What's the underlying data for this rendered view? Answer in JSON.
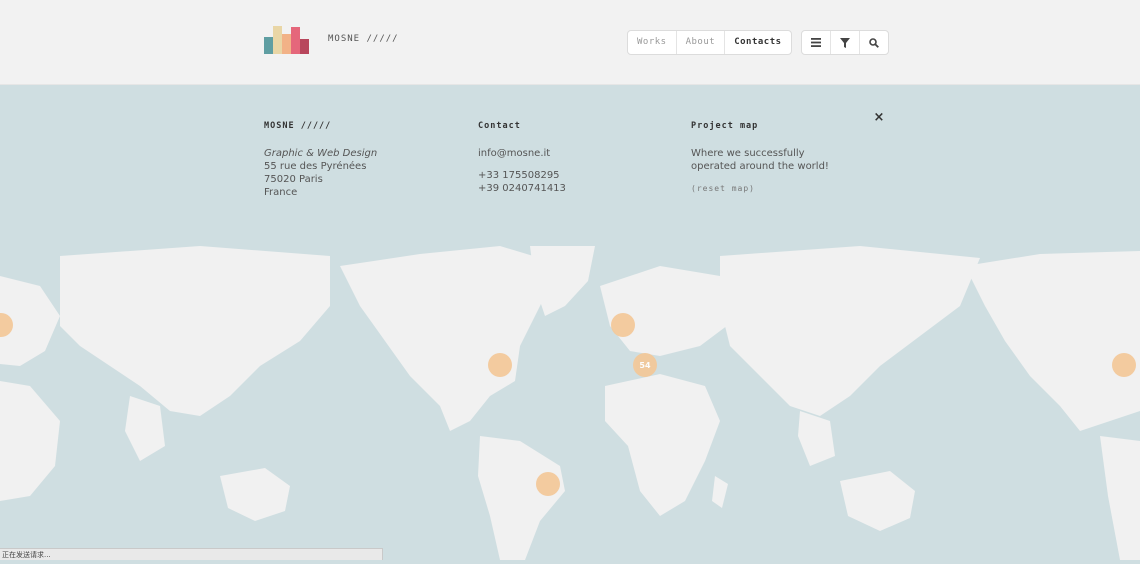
{
  "header": {
    "brand": "MOSNE /////",
    "nav": [
      {
        "label": "Works",
        "active": false
      },
      {
        "label": "About",
        "active": false
      },
      {
        "label": "Contacts",
        "active": true
      }
    ],
    "tools": [
      "menu-icon",
      "filter-icon",
      "search-icon"
    ],
    "logo_colors": [
      "#5f9ea2",
      "#e9d6a6",
      "#f2b287",
      "#e5677b",
      "#b8465c"
    ]
  },
  "panel": {
    "col1": {
      "heading": "MOSNE /////",
      "tagline": "Graphic & Web Design",
      "address1": "55 rue des Pyrénées",
      "address2": "75020 Paris",
      "country": "France"
    },
    "col2": {
      "heading": "Contact",
      "email": "info@mosne.it",
      "phone1": "+33 175508295",
      "phone2": "+39 0240741413"
    },
    "col3": {
      "heading": "Project map",
      "text1": "Where we successfully",
      "text2": "operated around the world!",
      "reset": "(reset map)"
    },
    "close": "×"
  },
  "map": {
    "water_color": "#cfdee1",
    "land_color": "#f1f1f1",
    "markers": [
      {
        "label": ""
      },
      {
        "label": ""
      },
      {
        "label": ""
      },
      {
        "label": "54"
      },
      {
        "label": ""
      },
      {
        "label": ""
      }
    ]
  },
  "status_bar": "正在发送请求..."
}
